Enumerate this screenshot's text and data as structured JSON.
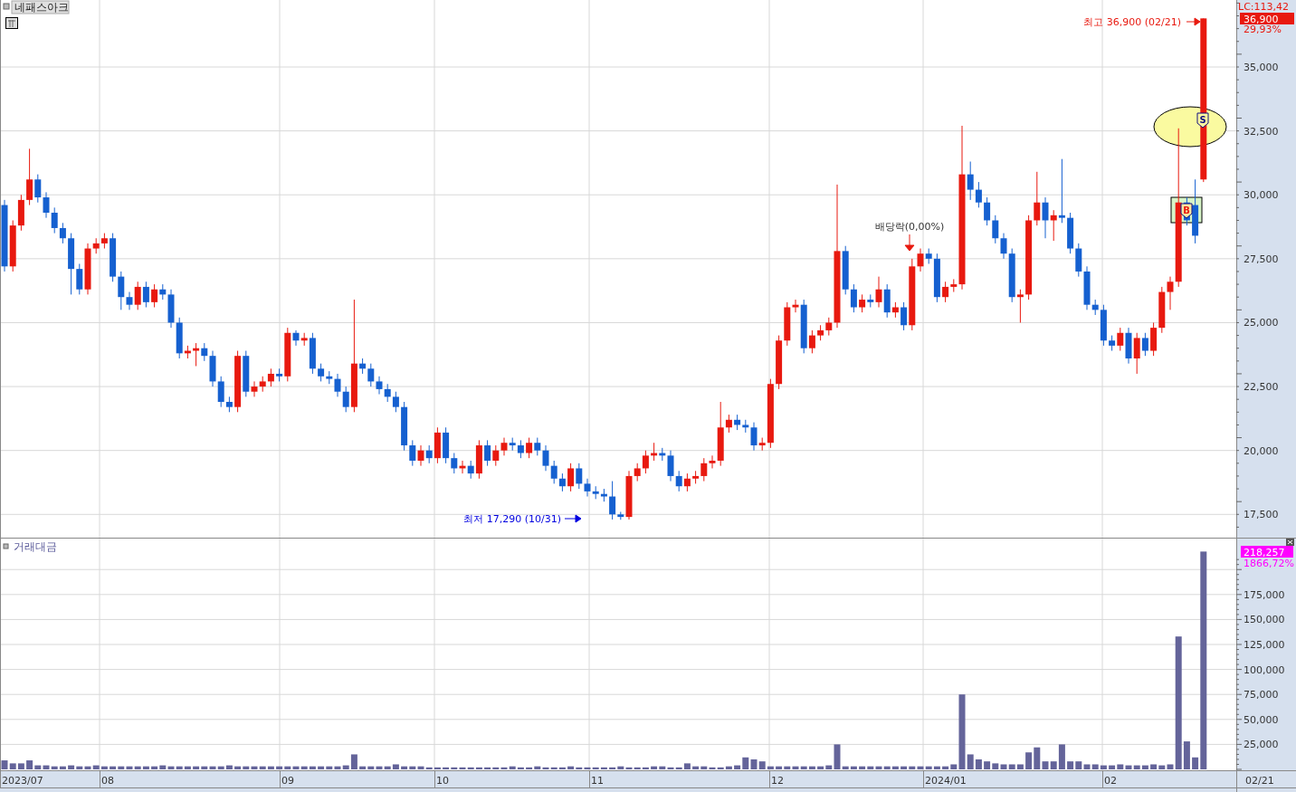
{
  "price_panel": {
    "title": "네패스아크",
    "lc_label": "LC:113,42",
    "current_price": "36,900",
    "change": "29,93%",
    "chart_data": {
      "type": "candlestick",
      "grid": true,
      "ylim": [
        16590,
        37620
      ],
      "yticks": [
        {
          "value": 35000,
          "label": "35,000"
        },
        {
          "value": 32500,
          "label": "32,500"
        },
        {
          "value": 30000,
          "label": "30,000"
        },
        {
          "value": 27500,
          "label": "27,500"
        },
        {
          "value": 25000,
          "label": "25,000"
        },
        {
          "value": 22500,
          "label": "22,500"
        },
        {
          "value": 20000,
          "label": "20,000"
        },
        {
          "value": 17500,
          "label": "17,500"
        }
      ],
      "ohlc": [
        [
          29600,
          29800,
          27000,
          27200
        ],
        [
          27200,
          29000,
          27000,
          28800
        ],
        [
          28800,
          30000,
          28600,
          29800
        ],
        [
          29800,
          31800,
          29600,
          30600
        ],
        [
          30600,
          30800,
          29700,
          29900
        ],
        [
          29900,
          30100,
          29100,
          29300
        ],
        [
          29300,
          29500,
          28500,
          28700
        ],
        [
          28700,
          28900,
          28100,
          28300
        ],
        [
          28300,
          28500,
          26100,
          27100
        ],
        [
          27100,
          27300,
          26100,
          26300
        ],
        [
          26300,
          28100,
          26100,
          27900
        ],
        [
          27900,
          28300,
          27700,
          28100
        ],
        [
          28100,
          28500,
          27900,
          28300
        ],
        [
          28300,
          28500,
          26600,
          26800
        ],
        [
          26800,
          27000,
          25500,
          26000
        ],
        [
          26000,
          26200,
          25500,
          25700
        ],
        [
          25700,
          26600,
          25500,
          26400
        ],
        [
          26400,
          26600,
          25600,
          25800
        ],
        [
          25800,
          26500,
          25600,
          26300
        ],
        [
          26300,
          26500,
          25900,
          26100
        ],
        [
          26100,
          26300,
          24800,
          25000
        ],
        [
          25000,
          25200,
          23600,
          23800
        ],
        [
          23800,
          24100,
          23600,
          23900
        ],
        [
          23900,
          24200,
          23300,
          24000
        ],
        [
          24000,
          24200,
          23500,
          23700
        ],
        [
          23700,
          23900,
          22500,
          22700
        ],
        [
          22700,
          22900,
          21700,
          21900
        ],
        [
          21900,
          22100,
          21500,
          21700
        ],
        [
          21700,
          23900,
          21500,
          23700
        ],
        [
          23700,
          23900,
          22100,
          22300
        ],
        [
          22300,
          22700,
          22100,
          22500
        ],
        [
          22500,
          22900,
          22300,
          22700
        ],
        [
          22700,
          23200,
          22500,
          23000
        ],
        [
          23000,
          23200,
          22700,
          22900
        ],
        [
          22900,
          24800,
          22700,
          24600
        ],
        [
          24600,
          24700,
          24100,
          24300
        ],
        [
          24300,
          24600,
          24100,
          24400
        ],
        [
          24400,
          24600,
          23000,
          23200
        ],
        [
          23200,
          23400,
          22700,
          22900
        ],
        [
          22900,
          23100,
          22600,
          22800
        ],
        [
          22800,
          23000,
          22100,
          22300
        ],
        [
          22300,
          22500,
          21500,
          21700
        ],
        [
          21700,
          25900,
          21500,
          23400
        ],
        [
          23400,
          23600,
          23000,
          23200
        ],
        [
          23200,
          23400,
          22500,
          22700
        ],
        [
          22700,
          22900,
          22200,
          22400
        ],
        [
          22400,
          22600,
          21900,
          22100
        ],
        [
          22100,
          22300,
          21500,
          21700
        ],
        [
          21700,
          21900,
          20000,
          20200
        ],
        [
          20200,
          20400,
          19400,
          19600
        ],
        [
          19600,
          20200,
          19400,
          20000
        ],
        [
          20000,
          20200,
          19500,
          19700
        ],
        [
          19700,
          20900,
          19500,
          20700
        ],
        [
          20700,
          20900,
          19500,
          19700
        ],
        [
          19700,
          19900,
          19100,
          19300
        ],
        [
          19300,
          19600,
          19100,
          19400
        ],
        [
          19400,
          19600,
          18900,
          19100
        ],
        [
          19100,
          20400,
          18900,
          20200
        ],
        [
          20200,
          20400,
          19400,
          19600
        ],
        [
          19600,
          20200,
          19400,
          20000
        ],
        [
          20000,
          20500,
          19800,
          20300
        ],
        [
          20300,
          20500,
          20000,
          20200
        ],
        [
          20200,
          20400,
          19700,
          19900
        ],
        [
          19900,
          20500,
          19700,
          20300
        ],
        [
          20300,
          20500,
          19800,
          20000
        ],
        [
          20000,
          20200,
          19200,
          19400
        ],
        [
          19400,
          19600,
          18700,
          18900
        ],
        [
          18900,
          19100,
          18400,
          18600
        ],
        [
          18600,
          19500,
          18400,
          19300
        ],
        [
          19300,
          19500,
          18500,
          18700
        ],
        [
          18700,
          18900,
          18200,
          18400
        ],
        [
          18400,
          18600,
          18100,
          18300
        ],
        [
          18300,
          18500,
          18000,
          18200
        ],
        [
          18200,
          18800,
          17300,
          17500
        ],
        [
          17500,
          17600,
          17290,
          17400
        ],
        [
          17400,
          19200,
          17300,
          19000
        ],
        [
          19000,
          19500,
          18800,
          19300
        ],
        [
          19300,
          20000,
          19100,
          19800
        ],
        [
          19800,
          20300,
          19600,
          19900
        ],
        [
          19900,
          20100,
          19600,
          19800
        ],
        [
          19800,
          20000,
          18800,
          19000
        ],
        [
          19000,
          19200,
          18400,
          18600
        ],
        [
          18600,
          19100,
          18400,
          18900
        ],
        [
          18900,
          19200,
          18700,
          19000
        ],
        [
          19000,
          19700,
          18800,
          19500
        ],
        [
          19500,
          19800,
          19300,
          19600
        ],
        [
          19600,
          21900,
          19400,
          20900
        ],
        [
          20900,
          21400,
          20700,
          21200
        ],
        [
          21200,
          21400,
          20800,
          21000
        ],
        [
          21000,
          21200,
          20700,
          20900
        ],
        [
          20900,
          21100,
          20000,
          20200
        ],
        [
          20200,
          20500,
          20000,
          20300
        ],
        [
          20300,
          22800,
          20100,
          22600
        ],
        [
          22600,
          24500,
          22400,
          24300
        ],
        [
          24300,
          25800,
          24100,
          25600
        ],
        [
          25600,
          25900,
          25400,
          25700
        ],
        [
          25700,
          25900,
          23800,
          24000
        ],
        [
          24000,
          24700,
          23800,
          24500
        ],
        [
          24500,
          24900,
          24300,
          24700
        ],
        [
          24700,
          25200,
          24500,
          25000
        ],
        [
          25000,
          30400,
          24800,
          27800
        ],
        [
          27800,
          28000,
          26100,
          26300
        ],
        [
          26300,
          26500,
          25400,
          25600
        ],
        [
          25600,
          26100,
          25400,
          25900
        ],
        [
          25900,
          26100,
          25600,
          25800
        ],
        [
          25800,
          26800,
          25600,
          26300
        ],
        [
          26300,
          26500,
          25200,
          25400
        ],
        [
          25400,
          25800,
          25200,
          25600
        ],
        [
          25600,
          25800,
          24700,
          24900
        ],
        [
          24900,
          27500,
          24700,
          27200
        ],
        [
          27200,
          27900,
          27000,
          27700
        ],
        [
          27700,
          27900,
          27300,
          27500
        ],
        [
          27500,
          27700,
          25800,
          26000
        ],
        [
          26000,
          26600,
          25800,
          26400
        ],
        [
          26400,
          26700,
          26200,
          26500
        ],
        [
          26500,
          32700,
          26300,
          30800
        ],
        [
          30800,
          31300,
          29800,
          30200
        ],
        [
          30200,
          30500,
          29500,
          29700
        ],
        [
          29700,
          29900,
          28800,
          29000
        ],
        [
          29000,
          29200,
          28100,
          28300
        ],
        [
          28300,
          28500,
          27500,
          27700
        ],
        [
          27700,
          27900,
          25800,
          26000
        ],
        [
          26000,
          26300,
          25000,
          26100
        ],
        [
          26100,
          29200,
          25900,
          29000
        ],
        [
          29000,
          30900,
          28800,
          29700
        ],
        [
          29700,
          29900,
          28300,
          29000
        ],
        [
          29000,
          29400,
          28200,
          29200
        ],
        [
          29200,
          31400,
          28900,
          29100
        ],
        [
          29100,
          29300,
          27700,
          27900
        ],
        [
          27900,
          28100,
          26800,
          27000
        ],
        [
          27000,
          27200,
          25500,
          25700
        ],
        [
          25700,
          25900,
          25300,
          25500
        ],
        [
          25500,
          25700,
          24100,
          24300
        ],
        [
          24300,
          24500,
          23900,
          24100
        ],
        [
          24100,
          24800,
          23900,
          24600
        ],
        [
          24600,
          24800,
          23400,
          23600
        ],
        [
          23600,
          24600,
          23000,
          24400
        ],
        [
          24400,
          24600,
          23700,
          23900
        ],
        [
          23900,
          25000,
          23700,
          24800
        ],
        [
          24800,
          26400,
          24600,
          26200
        ],
        [
          26200,
          26800,
          25500,
          26600
        ],
        [
          26600,
          32600,
          26400,
          29700
        ],
        [
          29700,
          29900,
          28800,
          29000
        ],
        [
          29600,
          30600,
          28100,
          28400
        ],
        [
          30600,
          36900,
          30500,
          36900
        ]
      ]
    },
    "annotations": [
      {
        "kind": "high",
        "text": "최고 36,900 (02/21)"
      },
      {
        "kind": "low",
        "text": "최저 17,290 (10/31)"
      },
      {
        "kind": "dividend",
        "text": "배당락(0,00%)"
      }
    ],
    "signals": [
      {
        "kind": "sell",
        "label": "S"
      },
      {
        "kind": "buy",
        "label": "B"
      }
    ]
  },
  "volume_panel": {
    "title": "거래대금",
    "current_value": "218,257",
    "change": "1866,72%",
    "chart_data": {
      "type": "bar",
      "grid": true,
      "ylim": [
        0,
        231000
      ],
      "yticks": [
        {
          "value": 175000,
          "label": "175,000"
        },
        {
          "value": 150000,
          "label": "150,000"
        },
        {
          "value": 125000,
          "label": "125,000"
        },
        {
          "value": 100000,
          "label": "100,000"
        },
        {
          "value": 75000,
          "label": "75,000"
        },
        {
          "value": 50000,
          "label": "50,000"
        },
        {
          "value": 25000,
          "label": "25,000"
        }
      ],
      "values": [
        9000,
        6000,
        6000,
        9000,
        4000,
        4000,
        3000,
        3000,
        4000,
        3000,
        3000,
        4000,
        3000,
        3000,
        3000,
        3000,
        3000,
        3000,
        3000,
        4000,
        3000,
        3000,
        3000,
        3000,
        3000,
        3000,
        3000,
        4000,
        3000,
        3000,
        3000,
        3000,
        3000,
        3000,
        3000,
        3000,
        3000,
        3000,
        3000,
        3000,
        3000,
        4000,
        15000,
        3000,
        3000,
        3000,
        3000,
        5000,
        3000,
        3000,
        3000,
        2000,
        2000,
        2000,
        2000,
        2000,
        2000,
        2000,
        2000,
        2000,
        2000,
        3000,
        2000,
        2000,
        3000,
        2000,
        2000,
        2000,
        3000,
        2000,
        2000,
        2000,
        2000,
        2000,
        3000,
        2000,
        2000,
        2000,
        3000,
        3000,
        2000,
        2000,
        6000,
        3000,
        3000,
        2000,
        2000,
        3000,
        4000,
        12000,
        10000,
        8000,
        3000,
        3000,
        3000,
        3000,
        3000,
        3000,
        3000,
        4000,
        25000,
        3000,
        3000,
        3000,
        3000,
        3000,
        3000,
        3000,
        3000,
        3000,
        3000,
        3000,
        3000,
        3000,
        5000,
        75000,
        15000,
        10000,
        8000,
        6000,
        5000,
        5000,
        5000,
        17000,
        22000,
        8000,
        8000,
        25000,
        8000,
        8000,
        5000,
        5000,
        4000,
        4000,
        5000,
        4000,
        4000,
        4000,
        5000,
        4000,
        5000,
        133000,
        28000,
        12000,
        218000
      ]
    }
  },
  "x_axis": {
    "labels": [
      "2023/07",
      "08",
      "09",
      "10",
      "11",
      "12",
      "2024/01",
      "02"
    ],
    "current_date": "02/21"
  }
}
